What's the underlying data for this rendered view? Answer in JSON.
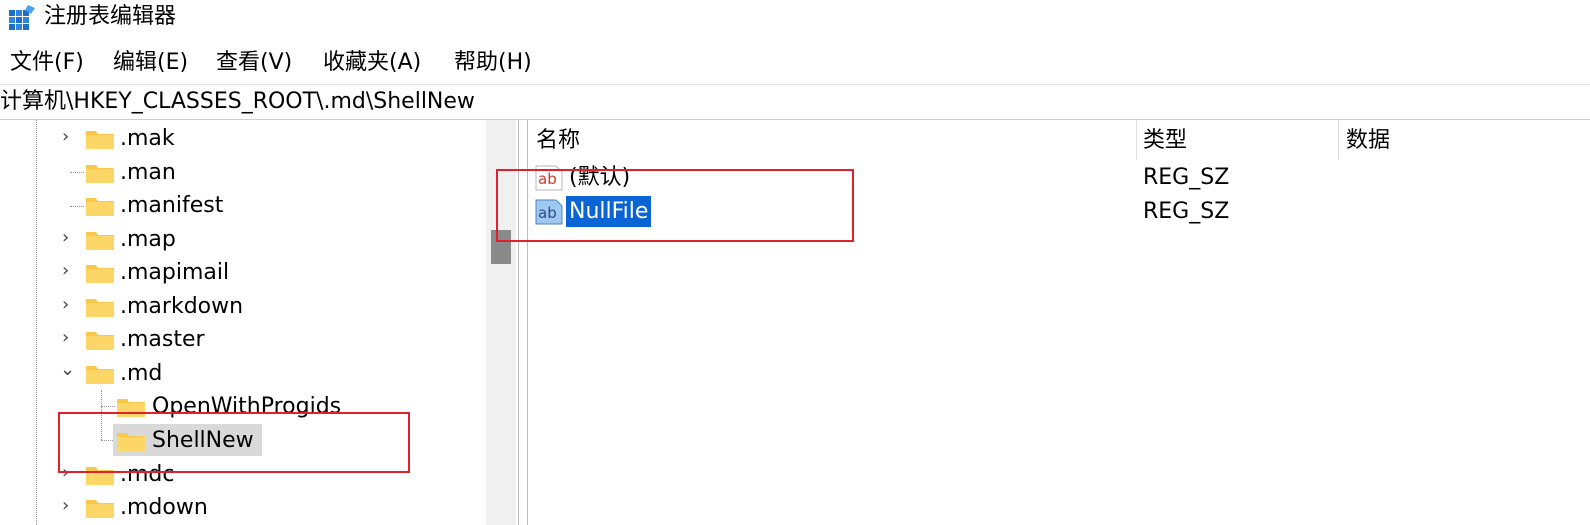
{
  "window": {
    "title": "注册表编辑器",
    "icon": "registry-editor-icon"
  },
  "menu": [
    {
      "label": "文件(F)"
    },
    {
      "label": "编辑(E)"
    },
    {
      "label": "查看(V)"
    },
    {
      "label": "收藏夹(A)"
    },
    {
      "label": "帮助(H)"
    }
  ],
  "address": {
    "path": "计算机\\HKEY_CLASSES_ROOT\\.md\\ShellNew"
  },
  "tree": {
    "items": [
      {
        "label": ".mak",
        "expander": "collapsed"
      },
      {
        "label": ".man",
        "expander": "none"
      },
      {
        "label": ".manifest",
        "expander": "none"
      },
      {
        "label": ".map",
        "expander": "collapsed"
      },
      {
        "label": ".mapimail",
        "expander": "collapsed"
      },
      {
        "label": ".markdown",
        "expander": "collapsed"
      },
      {
        "label": ".master",
        "expander": "collapsed"
      },
      {
        "label": ".md",
        "expander": "expanded"
      },
      {
        "label": "OpenWithProgids",
        "expander": "none",
        "child": true
      },
      {
        "label": "ShellNew",
        "expander": "none",
        "child": true,
        "selected": true
      },
      {
        "label": ".mdc",
        "expander": "collapsed"
      },
      {
        "label": ".mdown",
        "expander": "collapsed"
      }
    ]
  },
  "values_list": {
    "columns": [
      {
        "label": "名称"
      },
      {
        "label": "类型"
      },
      {
        "label": "数据"
      }
    ],
    "rows": [
      {
        "name": "(默认)",
        "type": "REG_SZ",
        "icon": "string-value-icon"
      },
      {
        "name": "NullFile",
        "type": "REG_SZ",
        "icon": "string-value-icon",
        "selected": true
      }
    ]
  },
  "colors": {
    "selection": "#0a64d4",
    "annotation": "#e0202a",
    "folder": "#f8c84a"
  }
}
